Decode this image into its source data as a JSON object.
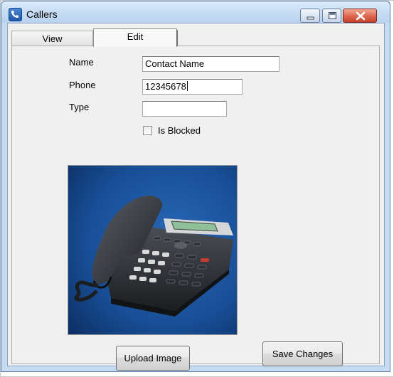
{
  "window": {
    "title": "Callers"
  },
  "tabs": [
    {
      "label": "View"
    },
    {
      "label": "Edit"
    }
  ],
  "form": {
    "name_label": "Name",
    "name_value": "Contact Name",
    "phone_label": "Phone",
    "phone_value": "12345678",
    "type_label": "Type",
    "type_value": "",
    "blocked_label": "Is Blocked",
    "blocked_checked": false
  },
  "buttons": {
    "upload_label": "Upload Image",
    "save_label": "Save Changes"
  },
  "colors": {
    "photo_bg": "#1a4f96",
    "close_button": "#c7412a"
  },
  "icons": {
    "app": "phone-icon",
    "minimize": "minimize-icon",
    "maximize": "maximize-icon",
    "close": "close-icon"
  }
}
